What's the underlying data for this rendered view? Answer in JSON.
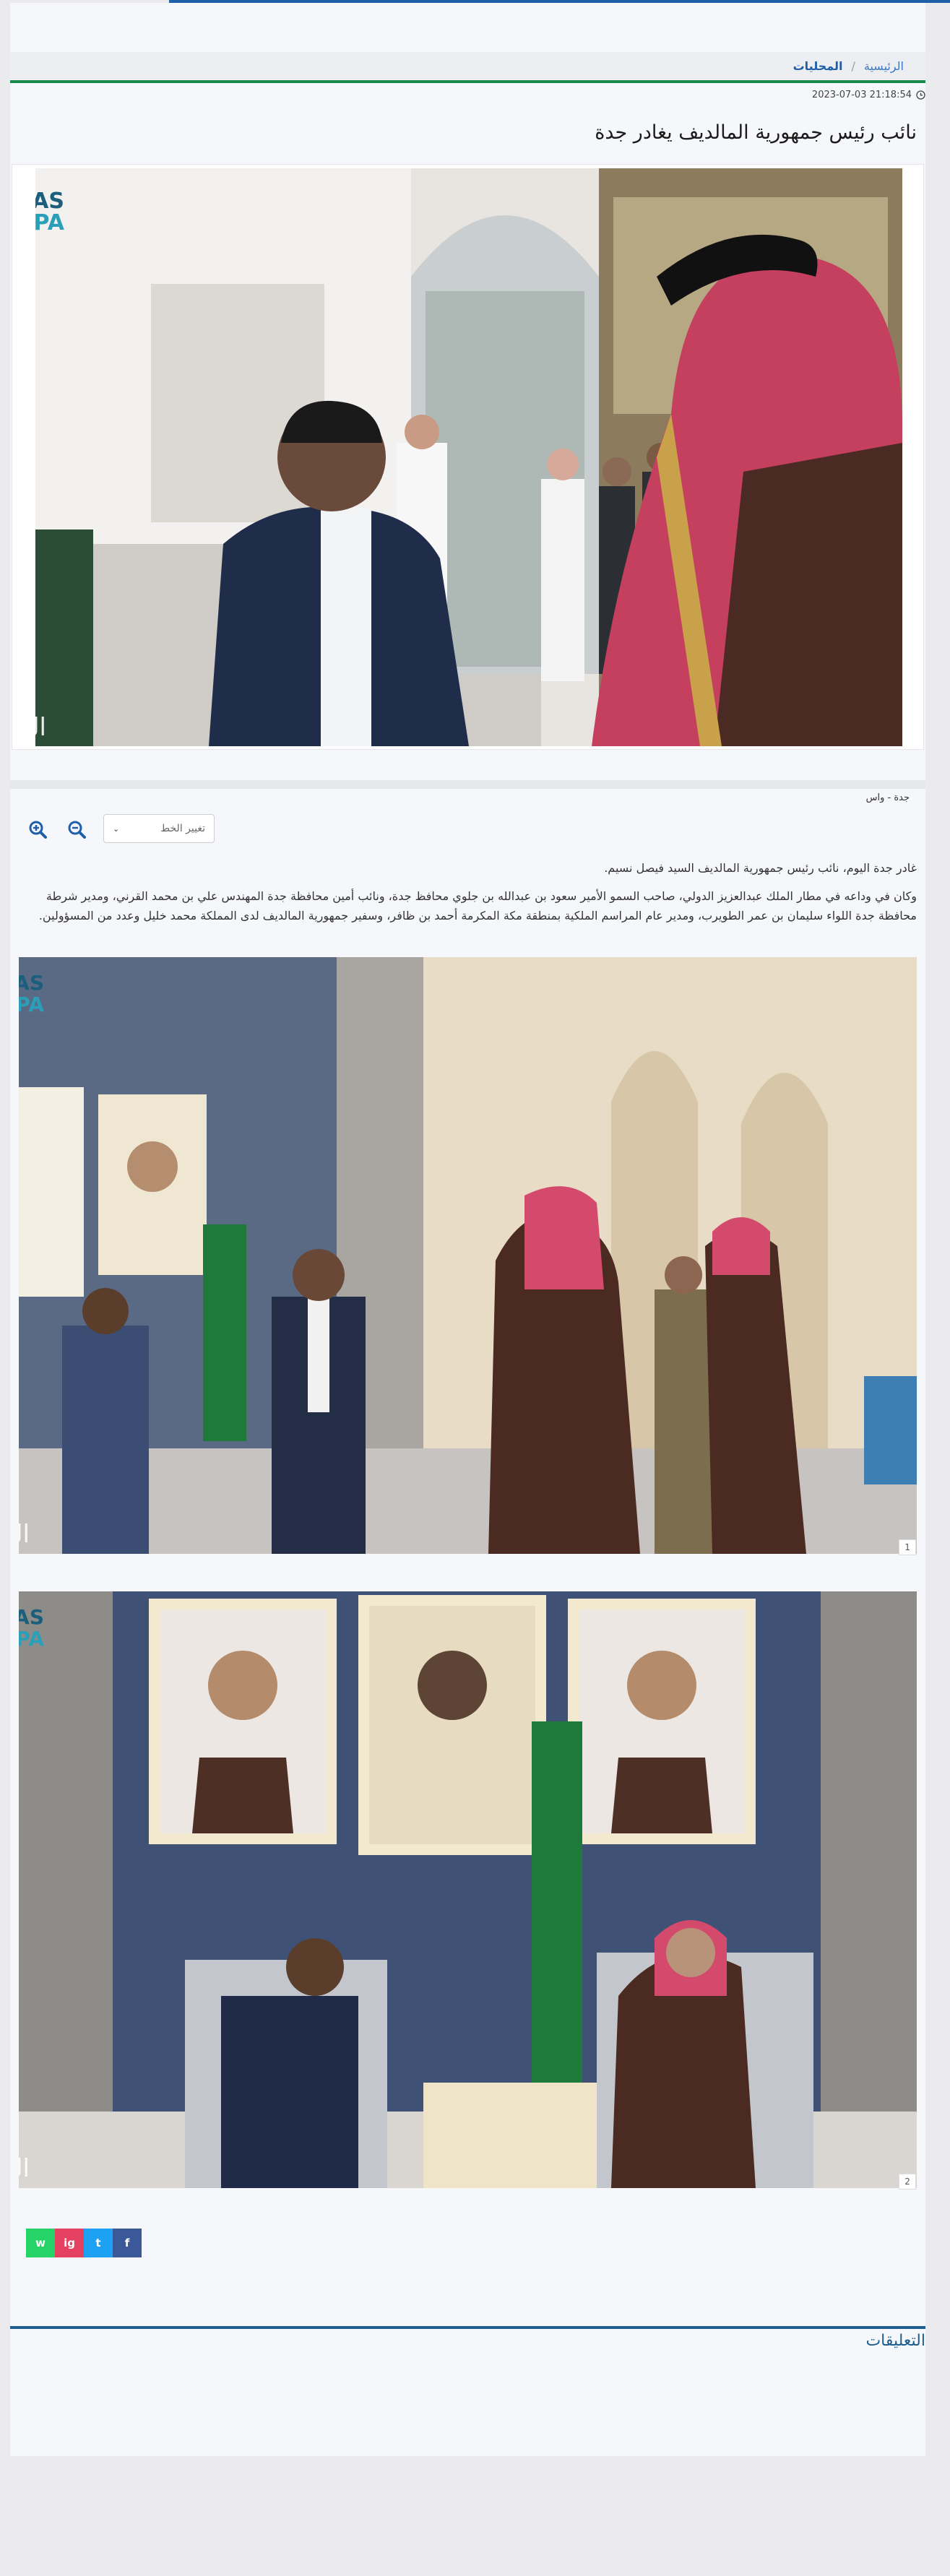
{
  "breadcrumb": {
    "home": "الرئيسية",
    "separator": "/",
    "current": "المحليات"
  },
  "article": {
    "datetime": "2023-07-03 21:18:54",
    "title": "نائب رئيس جمهورية المالديف يغادر جدة",
    "source": "جدة - واس",
    "paragraphs": [
      "غادر جدة اليوم، نائب رئيس جمهورية المالديف السيد فيصل نسيم.",
      "وكان في وداعه في مطار الملك عبدالعزيز الدولي، صاحب السمو الأمير سعود بن عبدالله بن جلوي محافظ جدة، ونائب أمين محافظة جدة المهندس علي بن محمد القرني، ومدير شرطة محافظة جدة اللواء سليمان بن عمر الطويرب، ومدير عام المراسم الملكية بمنطقة مكة المكرمة أحمد بن ظافر، وسفير جمهورية المالديف لدى المملكة محمد خليل وعدد من المسؤولين."
    ]
  },
  "toolbar": {
    "font_select_label": "تغيير الخط"
  },
  "gallery": {
    "counters": [
      "1",
      "2"
    ]
  },
  "watermarks": {
    "agency": "SPA",
    "newspaper": "الرياض"
  },
  "share": {
    "buttons": [
      {
        "label": "f",
        "color": "#3b5998"
      },
      {
        "label": "t",
        "color": "#1da1f2"
      },
      {
        "label": "ig",
        "color": "#e4405f"
      },
      {
        "label": "w",
        "color": "#25d366"
      }
    ]
  },
  "comments": {
    "title": "التعليقات"
  },
  "colors": {
    "brand_blue": "#1f5fa8",
    "green_rule": "#1a8a4a",
    "comments_blue": "#1f5f8f"
  }
}
